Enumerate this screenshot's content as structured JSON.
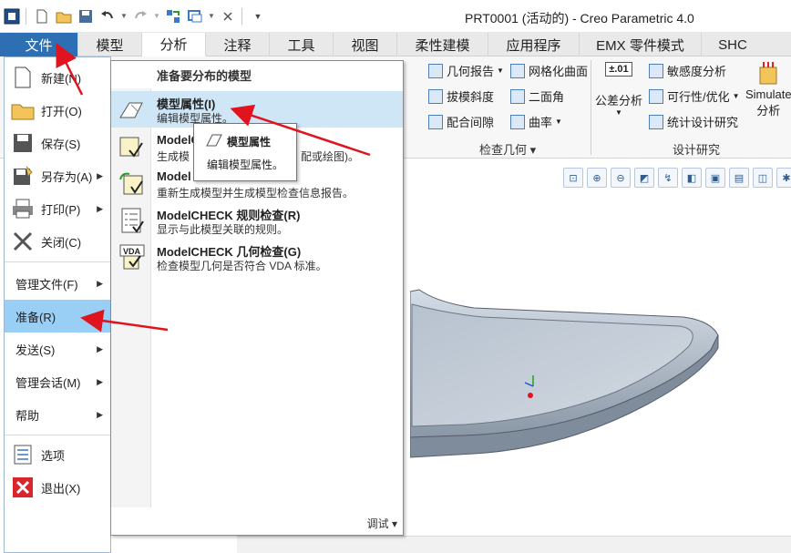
{
  "window": {
    "title": "PRT0001 (活动的) - Creo Parametric 4.0"
  },
  "quick_access": {
    "icons": [
      "app-icon",
      "new-icon",
      "open-icon",
      "save-icon",
      "undo-icon",
      "redo-icon",
      "regenerate-icon",
      "windows-icon",
      "close-window-icon",
      "customize-icon"
    ]
  },
  "tabs": [
    {
      "label": "文件",
      "state": "file"
    },
    {
      "label": "模型",
      "state": "normal"
    },
    {
      "label": "分析",
      "state": "active"
    },
    {
      "label": "注释",
      "state": "normal"
    },
    {
      "label": "工具",
      "state": "normal"
    },
    {
      "label": "视图",
      "state": "normal"
    },
    {
      "label": "柔性建模",
      "state": "normal"
    },
    {
      "label": "应用程序",
      "state": "normal"
    },
    {
      "label": "EMX 零件模式",
      "state": "normal"
    },
    {
      "label": "SHC",
      "state": "normal"
    }
  ],
  "ribbon": {
    "check_geometry": {
      "label": "检查几何",
      "items": [
        "几何报告",
        "网格化曲面",
        "拔模斜度",
        "二面角",
        "配合间隙",
        "曲率"
      ]
    },
    "design_study": {
      "label": "设计研究",
      "items": [
        "公差分析",
        "敏感度分析",
        "可行性/优化",
        "统计设计研究",
        "Simulate",
        "分析"
      ],
      "tolerance_value": "±.01"
    }
  },
  "file_menu": {
    "items": [
      {
        "label": "新建(N)",
        "icon": "new-document-icon"
      },
      {
        "label": "打开(O)",
        "icon": "open-folder-icon"
      },
      {
        "label": "保存(S)",
        "icon": "save-disk-icon"
      },
      {
        "label": "另存为(A)",
        "icon": "save-as-icon"
      },
      {
        "label": "打印(P)",
        "icon": "printer-icon"
      },
      {
        "label": "关闭(C)",
        "icon": "close-x-icon"
      },
      {
        "label": "管理文件(F)"
      },
      {
        "label": "准备(R)"
      },
      {
        "label": "发送(S)"
      },
      {
        "label": "管理会话(M)"
      },
      {
        "label": "帮助"
      },
      {
        "label": "选项",
        "icon": "options-list-icon"
      },
      {
        "label": "退出(X)",
        "icon": "exit-icon"
      }
    ]
  },
  "prepare_submenu": {
    "title": "准备要分布的模型",
    "items": [
      {
        "title": "模型属性(I)",
        "desc": "编辑模型属性。",
        "icon": "model-properties-icon"
      },
      {
        "title": "ModelC",
        "desc": "生成模",
        "desc_tail": "配或绘图)。",
        "icon": "modelcheck-icon"
      },
      {
        "title": "Model",
        "desc": "重新生成模型并生成模型检查信息报告。",
        "icon": "modelcheck-regenerate-icon"
      },
      {
        "title": "ModelCHECK 规则检查(R)",
        "desc": "显示与此模型关联的规则。",
        "icon": "rules-check-icon"
      },
      {
        "title": "ModelCHECK 几何检查(G)",
        "desc": "检查模型几何是否符合 VDA 标准。",
        "icon": "vda-check-icon"
      }
    ],
    "debug_label": "调试"
  },
  "tooltip": {
    "title": "模型属性",
    "desc": "编辑模型属性。"
  },
  "colors": {
    "file_tab": "#2c6fb3",
    "selected": "#99cff5",
    "highlight": "#cfe6f7",
    "arrow": "#e0141e",
    "part": "#b9c4d1"
  }
}
